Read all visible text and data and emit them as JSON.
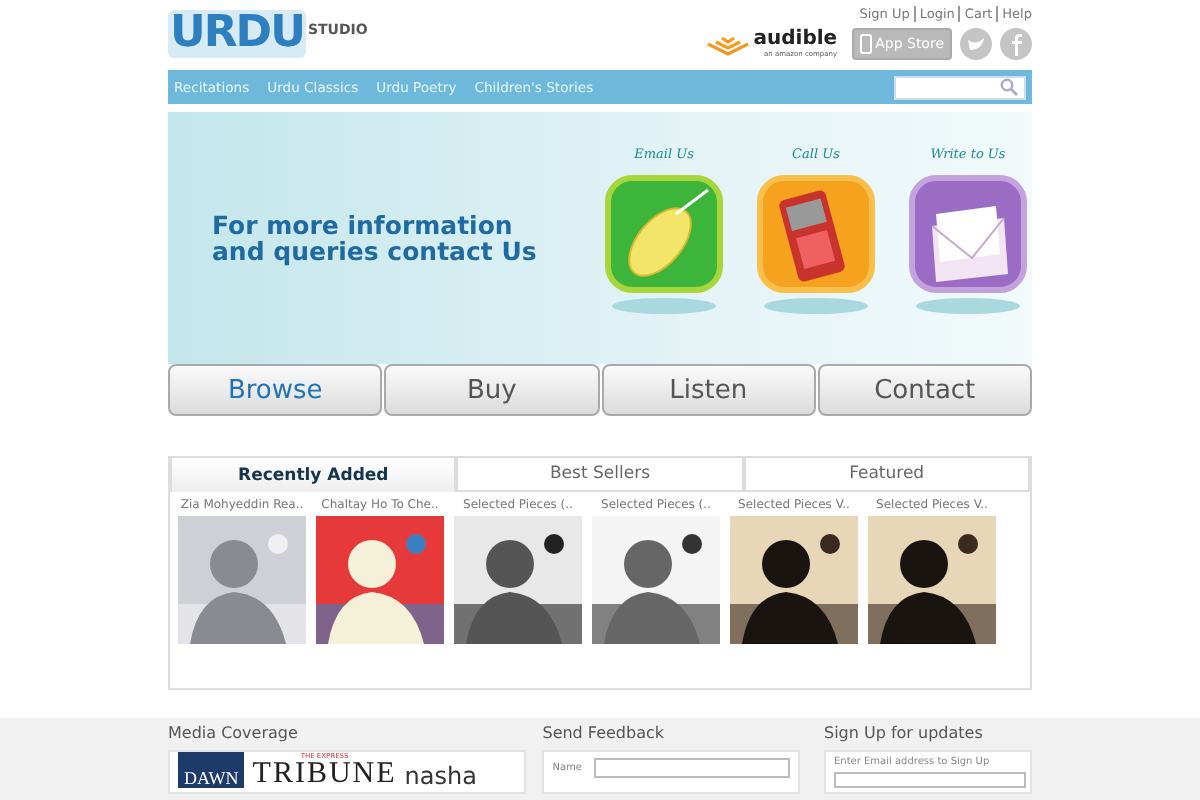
{
  "top_links": [
    "Sign Up",
    "Login",
    "Cart",
    "Help"
  ],
  "logo": {
    "main": "URDU",
    "sub": "STUDIO"
  },
  "audible": {
    "name": "audible",
    "tagline": "an amazon company"
  },
  "app_store": {
    "label": "App Store"
  },
  "nav": [
    {
      "label": "Recitations"
    },
    {
      "label": "Urdu Classics"
    },
    {
      "label": "Urdu Poetry"
    },
    {
      "label": "Children's Stories"
    }
  ],
  "banner": {
    "message": "For more information and queries contact Us",
    "contacts": [
      {
        "kind": "email",
        "label": "Email Us"
      },
      {
        "kind": "call",
        "label": "Call Us"
      },
      {
        "kind": "write",
        "label": "Write to Us"
      }
    ]
  },
  "main_buttons": [
    {
      "label": "Browse",
      "selected": true
    },
    {
      "label": "Buy",
      "selected": false
    },
    {
      "label": "Listen",
      "selected": false
    },
    {
      "label": "Contact",
      "selected": false
    }
  ],
  "tabs": [
    {
      "label": "Recently Added",
      "selected": true
    },
    {
      "label": "Best Sellers",
      "selected": false
    },
    {
      "label": "Featured",
      "selected": false
    }
  ],
  "items": [
    {
      "title": "Zia Mohyeddin Rea..",
      "kind": "picture"
    },
    {
      "title": "Chaltay Ho To Che..",
      "kind": "picture"
    },
    {
      "title": "Selected Pieces (..",
      "kind": "picture"
    },
    {
      "title": "Selected Pieces (..",
      "kind": "picture"
    },
    {
      "title": "Selected Pieces V..",
      "kind": "picture"
    },
    {
      "title": "Selected Pieces V..",
      "kind": "picture"
    }
  ],
  "footer": {
    "media": {
      "title": "Media Coverage",
      "logos": [
        "DAWN",
        "THE EXPRESS",
        "TRIBUNE",
        "nasha"
      ]
    },
    "feedback": {
      "title": "Send Feedback",
      "fields": [
        {
          "label": "Name"
        }
      ]
    },
    "signup": {
      "title": "Sign Up for updates",
      "hint": "Enter Email address to Sign Up"
    }
  }
}
